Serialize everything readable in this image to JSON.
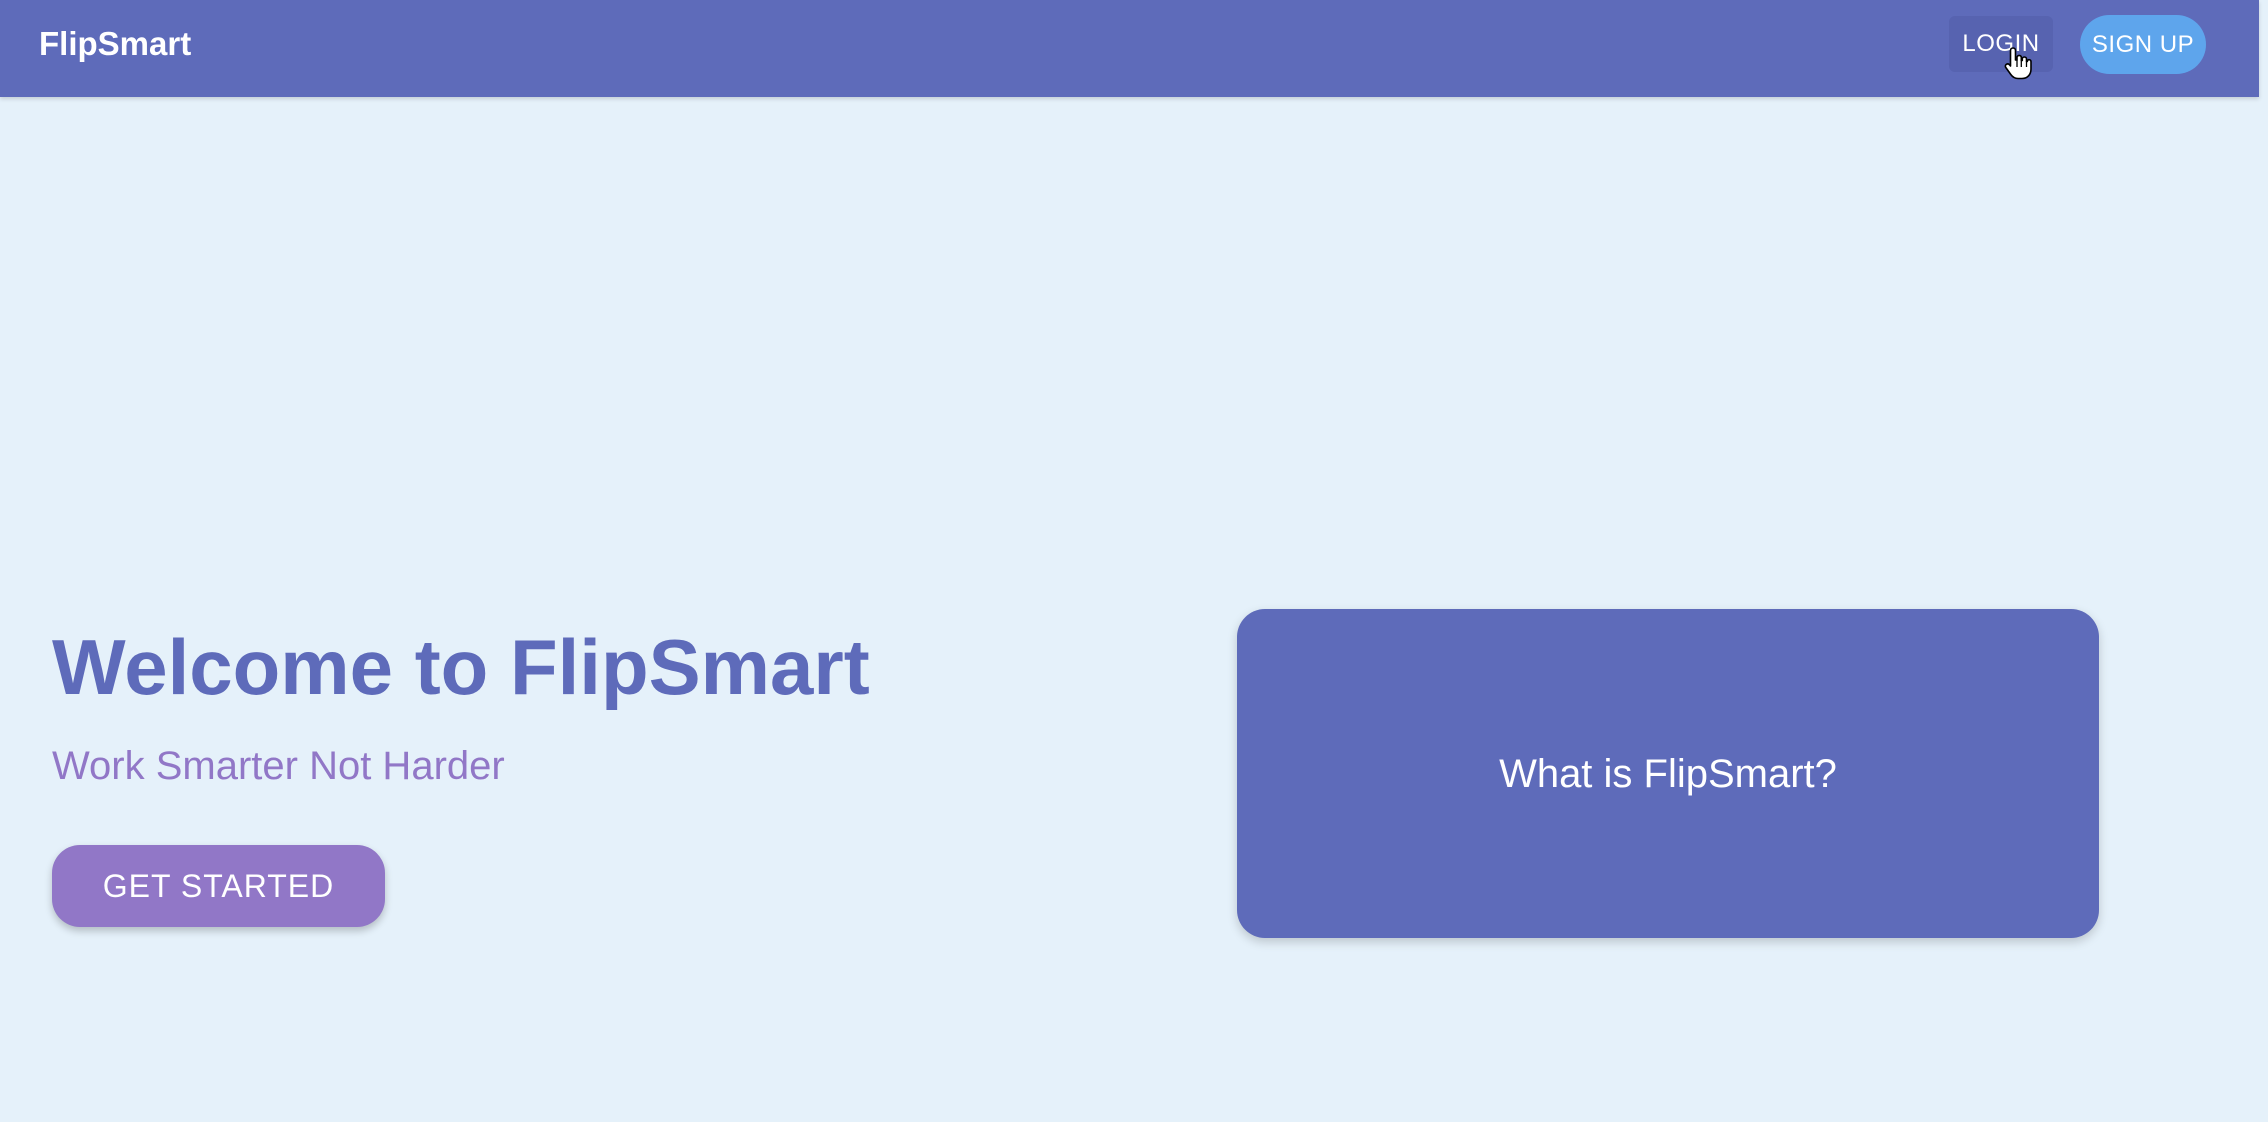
{
  "appbar": {
    "brand": "FlipSmart",
    "login_label": "LOGIN",
    "signup_label": "SIGN UP"
  },
  "hero": {
    "title": "Welcome to FlipSmart",
    "subtitle": "Work Smarter Not Harder",
    "cta_label": "GET STARTED"
  },
  "info_card": {
    "label": "What is FlipSmart?"
  },
  "colors": {
    "background": "#e5f1fa",
    "primary": "#5e6bba",
    "accent_purple": "#9177c7",
    "accent_blue": "#5ea5ec",
    "text_on_primary": "#ffffff"
  },
  "icons": {
    "cursor": "hand-pointer-icon"
  }
}
